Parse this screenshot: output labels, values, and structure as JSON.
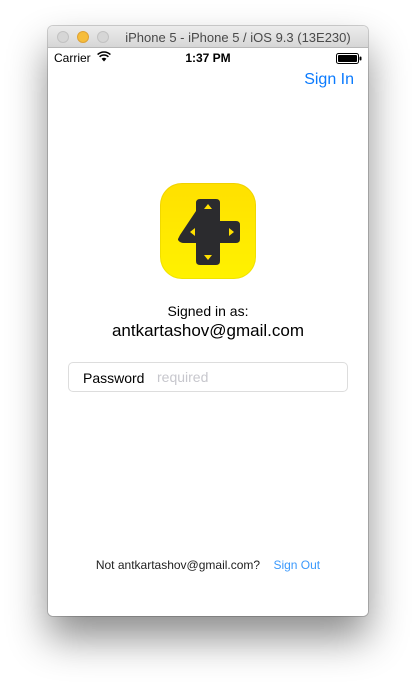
{
  "window": {
    "title": "iPhone 5 - iPhone 5 / iOS 9.3 (13E230)"
  },
  "status_bar": {
    "carrier": "Carrier",
    "time": "1:37 PM",
    "wifi_icon": "wifi-icon",
    "battery_icon": "battery-icon"
  },
  "nav": {
    "signin_label": "Sign In"
  },
  "app": {
    "icon": "gamepad-plus-icon",
    "icon_color": "#FFE800"
  },
  "account": {
    "signed_in_label": "Signed in as:",
    "email": "antkartashov@gmail.com"
  },
  "password": {
    "label": "Password",
    "placeholder": "required",
    "value": ""
  },
  "footer": {
    "not_user_text": "Not antkartashov@gmail.com?",
    "signout_label": "Sign Out"
  },
  "colors": {
    "accent": "#0A7AFE",
    "link": "#3B99FC"
  }
}
